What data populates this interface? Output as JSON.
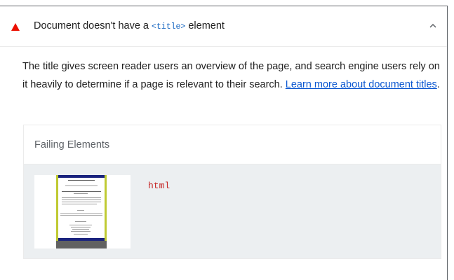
{
  "audit": {
    "title_before": "Document doesn't have a ",
    "title_code": "<title>",
    "title_after": " element",
    "expanded": true,
    "status_color": "#eb0f00"
  },
  "description": {
    "text": "The title gives screen reader users an overview of the page, and search engine users rely on it heavily to determine if a page is relevant to their search. ",
    "link_text": "Learn more about document titles",
    "trailing": "."
  },
  "table": {
    "header": "Failing Elements",
    "rows": [
      {
        "node": "html",
        "thumbnail": "page-screenshot"
      }
    ]
  },
  "icons": {
    "status": "fail-triangle-icon",
    "toggle": "chevron-up-icon"
  }
}
